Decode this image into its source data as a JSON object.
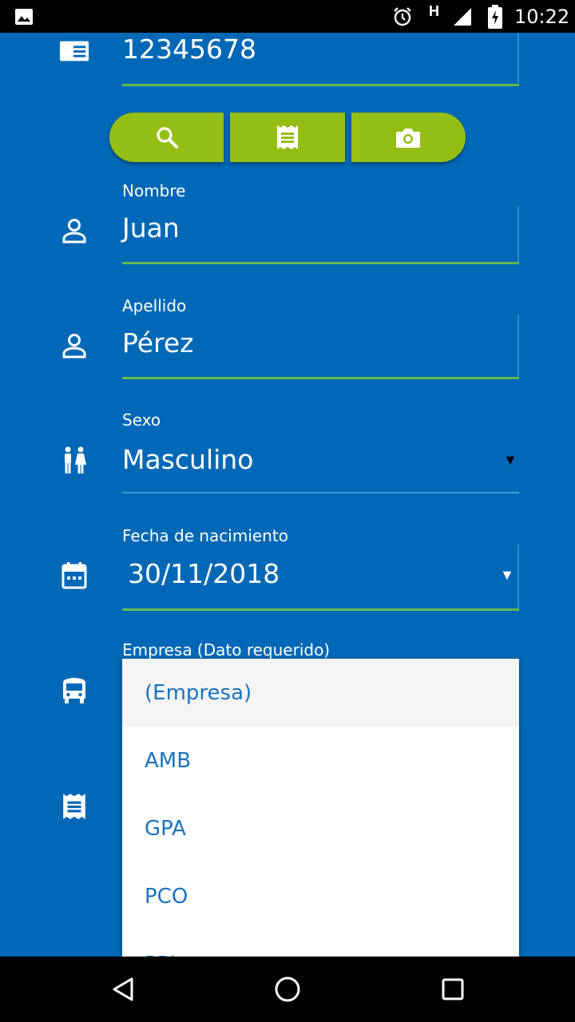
{
  "status_bar": {
    "time": "10:22",
    "network_letter": "H",
    "icons": [
      "image-icon",
      "alarm-icon",
      "signal-icon",
      "battery-charging-icon"
    ]
  },
  "form": {
    "document": {
      "value": "12345678",
      "icon": "id-card-icon"
    },
    "buttons": [
      {
        "name": "search-button",
        "icon": "search-icon"
      },
      {
        "name": "receipt-button",
        "icon": "receipt-icon"
      },
      {
        "name": "camera-button",
        "icon": "camera-icon"
      }
    ],
    "nombre": {
      "label": "Nombre",
      "value": "Juan",
      "icon": "person-icon"
    },
    "apellido": {
      "label": "Apellido",
      "value": "Pérez",
      "icon": "person-icon"
    },
    "sexo": {
      "label": "Sexo",
      "value": "Masculino",
      "icon": "wc-icon"
    },
    "fecha": {
      "label": "Fecha de nacimiento",
      "value": "30/11/2018",
      "icon": "calendar-icon"
    },
    "empresa": {
      "label": "Empresa (Dato requerido)",
      "icon": "bus-icon"
    },
    "extra": {
      "icon": "receipt-icon"
    }
  },
  "dropdown": {
    "options": [
      "(Empresa)",
      "AMB",
      "GPA",
      "PCO",
      "PPL"
    ],
    "selected_index": 0
  },
  "colors": {
    "background": "#0068b6",
    "accent_green": "#95be15",
    "underline_green": "#66b84d",
    "option_text": "#1a72c0"
  }
}
